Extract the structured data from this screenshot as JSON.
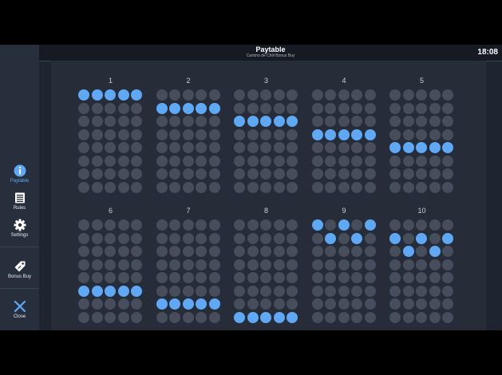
{
  "header": {
    "title": "Paytable",
    "subtitle": "Camino de Chili Bonus Buy",
    "clock": "18:08"
  },
  "sidebar": {
    "items": [
      {
        "id": "paytable",
        "label": "Paytable",
        "icon": "info-icon",
        "active": true
      },
      {
        "id": "rules",
        "label": "Rules",
        "icon": "book-icon",
        "active": false
      },
      {
        "id": "settings",
        "label": "Settings",
        "icon": "gear-icon",
        "active": false
      },
      {
        "id": "bonus-buy",
        "label": "Bonus Buy",
        "icon": "tag-icon",
        "active": false
      },
      {
        "id": "close",
        "label": "Close",
        "icon": "close-icon",
        "active": false
      }
    ]
  },
  "grid": {
    "columns": 5,
    "rows": 8
  },
  "colors": {
    "active_dot": "#5fa8f5",
    "inactive_dot": "#464e5c",
    "accent": "#5fa8f5"
  },
  "patterns": [
    {
      "number": "1",
      "active": [
        [
          0,
          0
        ],
        [
          1,
          0
        ],
        [
          2,
          0
        ],
        [
          3,
          0
        ],
        [
          4,
          0
        ]
      ]
    },
    {
      "number": "2",
      "active": [
        [
          0,
          1
        ],
        [
          1,
          1
        ],
        [
          2,
          1
        ],
        [
          3,
          1
        ],
        [
          4,
          1
        ]
      ]
    },
    {
      "number": "3",
      "active": [
        [
          0,
          2
        ],
        [
          1,
          2
        ],
        [
          2,
          2
        ],
        [
          3,
          2
        ],
        [
          4,
          2
        ]
      ]
    },
    {
      "number": "4",
      "active": [
        [
          0,
          3
        ],
        [
          1,
          3
        ],
        [
          2,
          3
        ],
        [
          3,
          3
        ],
        [
          4,
          3
        ]
      ]
    },
    {
      "number": "5",
      "active": [
        [
          0,
          4
        ],
        [
          1,
          4
        ],
        [
          2,
          4
        ],
        [
          3,
          4
        ],
        [
          4,
          4
        ]
      ]
    },
    {
      "number": "6",
      "active": [
        [
          0,
          5
        ],
        [
          1,
          5
        ],
        [
          2,
          5
        ],
        [
          3,
          5
        ],
        [
          4,
          5
        ]
      ]
    },
    {
      "number": "7",
      "active": [
        [
          0,
          6
        ],
        [
          1,
          6
        ],
        [
          2,
          6
        ],
        [
          3,
          6
        ],
        [
          4,
          6
        ]
      ]
    },
    {
      "number": "8",
      "active": [
        [
          0,
          7
        ],
        [
          1,
          7
        ],
        [
          2,
          7
        ],
        [
          3,
          7
        ],
        [
          4,
          7
        ]
      ]
    },
    {
      "number": "9",
      "active": [
        [
          0,
          0
        ],
        [
          1,
          1
        ],
        [
          2,
          0
        ],
        [
          3,
          1
        ],
        [
          4,
          0
        ]
      ]
    },
    {
      "number": "10",
      "active": [
        [
          0,
          1
        ],
        [
          1,
          2
        ],
        [
          2,
          1
        ],
        [
          3,
          2
        ],
        [
          4,
          1
        ]
      ]
    }
  ]
}
